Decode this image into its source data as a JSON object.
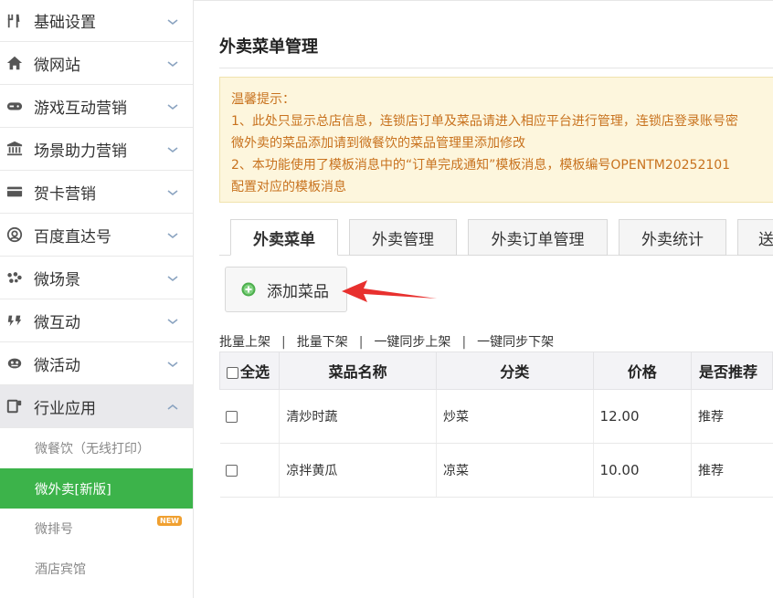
{
  "sidebar": {
    "items": [
      {
        "label": "基础设置",
        "icon": "utensils-icon"
      },
      {
        "label": "微网站",
        "icon": "home-icon"
      },
      {
        "label": "游戏互动营销",
        "icon": "gamepad-icon"
      },
      {
        "label": "场景助力营销",
        "icon": "bank-icon"
      },
      {
        "label": "贺卡营销",
        "icon": "card-icon"
      },
      {
        "label": "百度直达号",
        "icon": "baidu-icon"
      },
      {
        "label": "微场景",
        "icon": "scene-icon"
      },
      {
        "label": "微互动",
        "icon": "interaction-icon"
      },
      {
        "label": "微活动",
        "icon": "activity-icon"
      },
      {
        "label": "行业应用",
        "icon": "industry-icon"
      }
    ],
    "sub_items": [
      {
        "label": "微餐饮（无线打印）"
      },
      {
        "label": "微外卖[新版]"
      },
      {
        "label": "微排号",
        "badge": "NEW"
      },
      {
        "label": "酒店宾馆"
      }
    ]
  },
  "main": {
    "title": "外卖菜单管理",
    "tips": [
      "温馨提示：",
      "1、此处只显示总店信息，连锁店订单及菜品请进入相应平台进行管理，连锁店登录账号密",
      "微外卖的菜品添加请到微餐饮的菜品管理里添加修改",
      "2、本功能使用了模板消息中的“订单完成通知”模板消息，模板编号OPENTM20252101",
      "配置对应的模板消息"
    ],
    "tabs": [
      "外卖菜单",
      "外卖管理",
      "外卖订单管理",
      "外卖统计",
      "送"
    ],
    "add_button": "添加菜品",
    "batch_actions": [
      "批量上架",
      "批量下架",
      "一键同步上架",
      "一键同步下架"
    ],
    "table": {
      "select_all": "全选",
      "headers": [
        "菜品名称",
        "分类",
        "价格",
        "是否推荐"
      ],
      "rows": [
        {
          "name": "清炒时蔬",
          "category": "炒菜",
          "price": "12.00",
          "recommend": "推荐"
        },
        {
          "name": "凉拌黄瓜",
          "category": "凉菜",
          "price": "10.00",
          "recommend": "推荐"
        }
      ]
    }
  },
  "colors": {
    "accent_green": "#3cb34a",
    "tips_text": "#c8721e",
    "tips_bg": "#fdf6dd",
    "arrow_red": "#e8302e"
  }
}
